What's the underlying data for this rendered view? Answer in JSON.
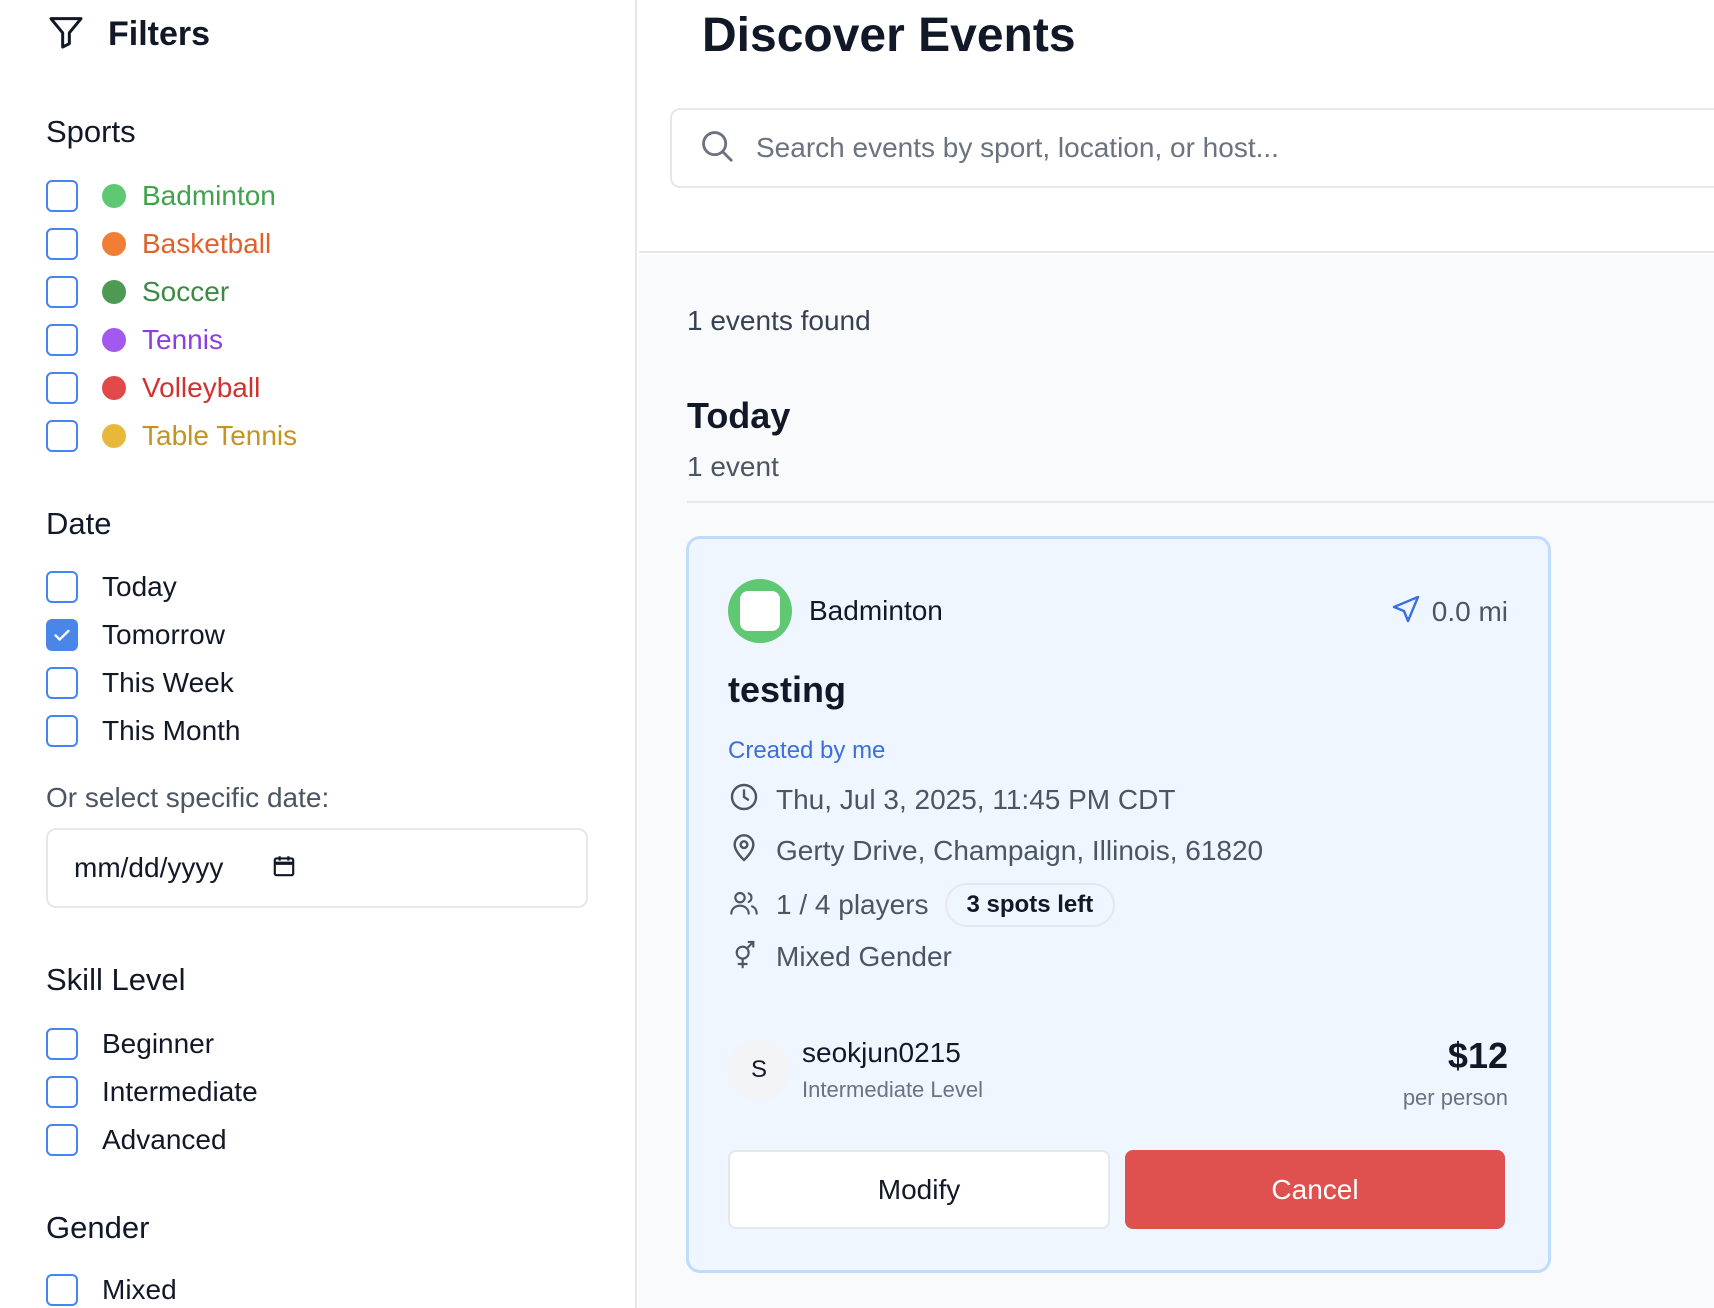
{
  "sidebar": {
    "title": "Filters",
    "sports_title": "Sports",
    "sports": [
      {
        "label": "Badminton",
        "color": "#5fc872",
        "text_color": "#3fa34d",
        "checked": false
      },
      {
        "label": "Basketball",
        "color": "#f07f35",
        "text_color": "#e0622a",
        "checked": false
      },
      {
        "label": "Soccer",
        "color": "#4e9a55",
        "text_color": "#3d8a45",
        "checked": false
      },
      {
        "label": "Tennis",
        "color": "#a259f0",
        "text_color": "#8b3fe0",
        "checked": false
      },
      {
        "label": "Volleyball",
        "color": "#e14a48",
        "text_color": "#d2322f",
        "checked": false
      },
      {
        "label": "Table Tennis",
        "color": "#e8b83a",
        "text_color": "#c49420",
        "checked": false
      }
    ],
    "date_title": "Date",
    "dates": [
      {
        "label": "Today",
        "checked": false
      },
      {
        "label": "Tomorrow",
        "checked": true
      },
      {
        "label": "This Week",
        "checked": false
      },
      {
        "label": "This Month",
        "checked": false
      }
    ],
    "specific_date_label": "Or select specific date:",
    "date_placeholder": "mm/dd/yyyy",
    "skill_title": "Skill Level",
    "skills": [
      {
        "label": "Beginner",
        "checked": false
      },
      {
        "label": "Intermediate",
        "checked": false
      },
      {
        "label": "Advanced",
        "checked": false
      }
    ],
    "gender_title": "Gender",
    "genders": [
      {
        "label": "Mixed",
        "checked": false
      }
    ]
  },
  "main": {
    "title": "Discover Events",
    "search_placeholder": "Search events by sport, location, or host...",
    "events_found": "1 events found",
    "group": {
      "title": "Today",
      "count": "1 event"
    },
    "card": {
      "sport": "Badminton",
      "sport_color": "#5fc872",
      "distance": "0.0 mi",
      "title": "testing",
      "created_by": "Created by me",
      "datetime": "Thu, Jul 3, 2025, 11:45 PM CDT",
      "location": "Gerty Drive, Champaign, Illinois, 61820",
      "players": "1 / 4 players",
      "spots_left": "3 spots left",
      "gender": "Mixed Gender",
      "host_initial": "S",
      "host_name": "seokjun0215",
      "host_level": "Intermediate Level",
      "price": "$12",
      "price_unit": "per person",
      "modify_label": "Modify",
      "cancel_label": "Cancel"
    }
  }
}
